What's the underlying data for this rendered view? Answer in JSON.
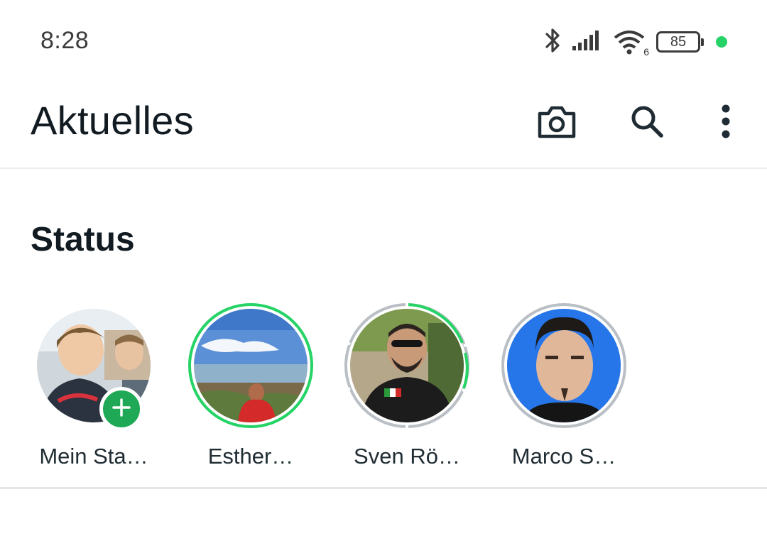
{
  "status_bar": {
    "time": "8:28",
    "battery": "85",
    "wifi_badge": "6",
    "icons": [
      "bluetooth-icon",
      "signal-icon",
      "wifi-icon",
      "battery-icon"
    ],
    "indicator_color": "#25d366"
  },
  "header": {
    "title": "Aktuelles",
    "actions": [
      "camera-icon",
      "search-icon",
      "more-vert-icon"
    ]
  },
  "status_section": {
    "title": "Status",
    "items": [
      {
        "name": "Mein Sta…",
        "ring": "none",
        "has_add": true
      },
      {
        "name": "Esther…",
        "ring": "unseen"
      },
      {
        "name": "Sven Rö…",
        "ring": "partial"
      },
      {
        "name": "Marco S…",
        "ring": "seen"
      }
    ]
  },
  "colors": {
    "accent": "#25d366",
    "add_button": "#1fa855",
    "seen_ring": "#b9bfc4",
    "text": "#111b21"
  }
}
